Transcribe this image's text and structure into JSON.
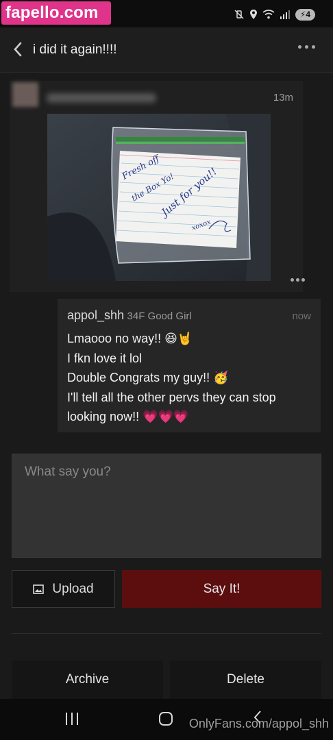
{
  "watermark_top": "fapello.com",
  "status_bar": {
    "icons": [
      "mute-vibrate-icon",
      "location-icon",
      "wifi-icon",
      "signal-icon"
    ],
    "battery": "4"
  },
  "header": {
    "title": "i did it again!!!!",
    "back_icon": "chevron-left-icon",
    "more_icon": "more-horizontal-icon"
  },
  "original_message": {
    "time": "13m",
    "photo": {
      "note_lines": [
        "Fresh off",
        "the Box Yo!",
        "Just for you!!",
        "xoxox"
      ]
    }
  },
  "reply": {
    "username": "appol_shh",
    "tagline": "34F Good Girl",
    "time": "now",
    "lines": [
      "Lmaooo no way!! 😆🤘",
      "I fkn love it lol",
      "Double Congrats my guy!! 🥳",
      "I'll tell all the other pervs they can stop",
      "looking now!! 💗💗💗"
    ]
  },
  "compose": {
    "placeholder": "What say you?"
  },
  "buttons": {
    "upload": "Upload",
    "say_it": "Say It!",
    "archive": "Archive",
    "delete": "Delete"
  },
  "colors": {
    "accent_red": "#5c0e0e",
    "watermark_pink": "#e0338a"
  },
  "watermark_bottom": "OnlyFans.com/appol_shh"
}
